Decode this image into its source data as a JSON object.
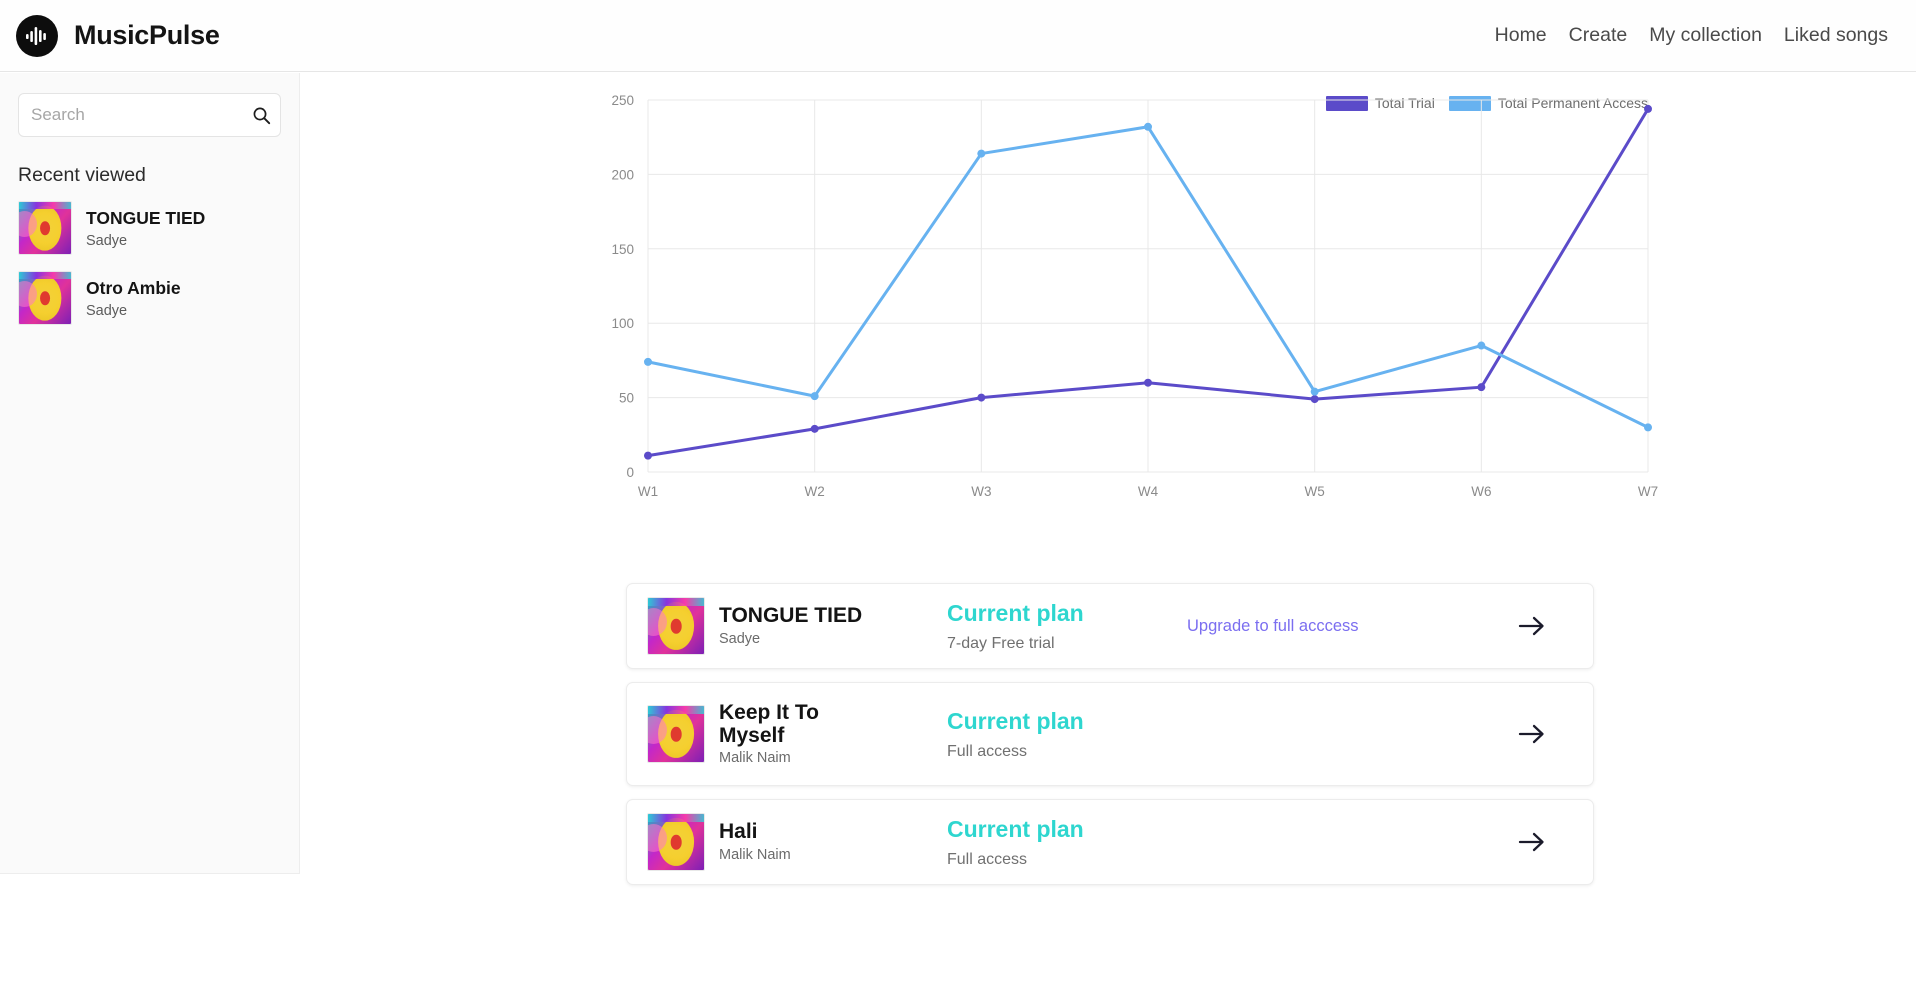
{
  "header": {
    "brand": "MusicPulse",
    "logo_icon": "pulse-logo-icon",
    "nav": [
      {
        "label": "Home"
      },
      {
        "label": "Create"
      },
      {
        "label": "My collection"
      },
      {
        "label": "Liked songs"
      }
    ]
  },
  "sidebar": {
    "search": {
      "placeholder": "Search",
      "value": "",
      "icon": "search-icon"
    },
    "section_title": "Recent viewed",
    "items": [
      {
        "title": "TONGUE TIED",
        "artist": "Sadye",
        "art": "album-art"
      },
      {
        "title": "Otro Ambie",
        "artist": "Sadye",
        "art": "album-art"
      }
    ]
  },
  "chart_data": {
    "type": "line",
    "title": "",
    "xlabel": "",
    "ylabel": "",
    "categories": [
      "W1",
      "W2",
      "W3",
      "W4",
      "W5",
      "W6",
      "W7"
    ],
    "ylim": [
      0,
      250
    ],
    "yticks": [
      0,
      50,
      100,
      150,
      200,
      250
    ],
    "grid": true,
    "legend_position": "top-right",
    "series": [
      {
        "name": "Total Trial",
        "color": "#5b4bc9",
        "values": [
          11,
          29,
          50,
          60,
          49,
          57,
          244
        ]
      },
      {
        "name": "Total Permanent Access",
        "color": "#67b2f0",
        "values": [
          74,
          51,
          214,
          232,
          54,
          85,
          30
        ]
      }
    ]
  },
  "cards": [
    {
      "title": "TONGUE TIED",
      "artist": "Sadye",
      "plan_head": "Current plan",
      "plan_sub": "7-day Free trial",
      "action_label": "Upgrade to full acccess",
      "arrow_icon": "arrow-right-icon"
    },
    {
      "title": "Keep It To Myself",
      "artist": "Malik Naim",
      "plan_head": "Current plan",
      "plan_sub": "Full access",
      "action_label": "",
      "arrow_icon": "arrow-right-icon"
    },
    {
      "title": "Hali",
      "artist": "Malik Naim",
      "plan_head": "Current plan",
      "plan_sub": "Full access",
      "action_label": "",
      "arrow_icon": "arrow-right-icon"
    }
  ],
  "colors": {
    "accent_teal": "#2ed6cf",
    "trial_purple": "#5b4bc9",
    "permanent_blue": "#67b2f0",
    "link_purple": "#7b6ef0"
  }
}
